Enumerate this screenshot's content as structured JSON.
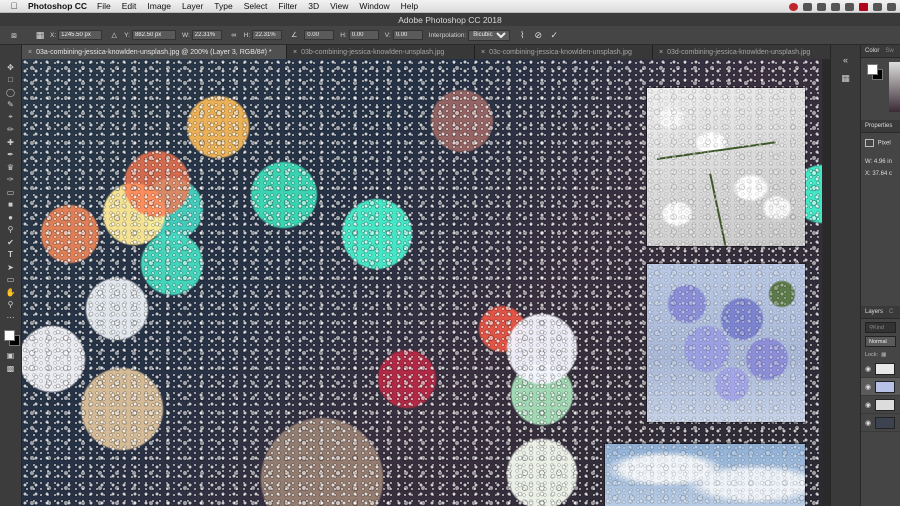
{
  "menubar": {
    "apple": "",
    "app_name": "Photoshop CC",
    "items": [
      "File",
      "Edit",
      "Image",
      "Layer",
      "Type",
      "Select",
      "Filter",
      "3D",
      "View",
      "Window",
      "Help"
    ]
  },
  "titlebar": {
    "title": "Adobe Photoshop CC 2018"
  },
  "options": {
    "x_label": "X:",
    "x_value": "1245.50 px",
    "y_label": "Y:",
    "y_value": "882.50 px",
    "w_label": "W:",
    "w_value": "22.31%",
    "h_label": "H:",
    "h_value": "22.31%",
    "angle_value": "0.00",
    "hskew_label": "H:",
    "hskew_value": "0.00",
    "vskew_label": "V:",
    "vskew_value": "0.00",
    "interp_label": "Interpolation:",
    "interp_value": "Bicubic"
  },
  "tabs": [
    {
      "label": "03a-combining-jessica-knowlden-unsplash.jpg @ 200% (Layer 3, RGB/8#) *",
      "active": true
    },
    {
      "label": "03b-combining-jessica-knowlden-unsplash.jpg",
      "active": false
    },
    {
      "label": "03c-combining-jessica-knowlden-unsplash.jpg",
      "active": false
    },
    {
      "label": "03d-combining-jessica-knowlden-unsplash.jpg",
      "active": false
    }
  ],
  "panels": {
    "color_tab": "Color",
    "swatches_tab": "Sw",
    "properties_tab": "Properties",
    "prop_kind": "Pixel",
    "prop_w_label": "W:",
    "prop_w_value": "4.96 in",
    "prop_x_label": "X:",
    "prop_x_value": "37.64 c",
    "layers_tab": "Layers",
    "layers_tab2": "C",
    "layers_search": "Kind",
    "blend_mode": "Normal",
    "lock_label": "Lock:"
  },
  "colors": {
    "menubar": "#e6e6e6",
    "chrome": "#3a3a3a",
    "panel": "#454545",
    "active_tab": "#505050"
  }
}
